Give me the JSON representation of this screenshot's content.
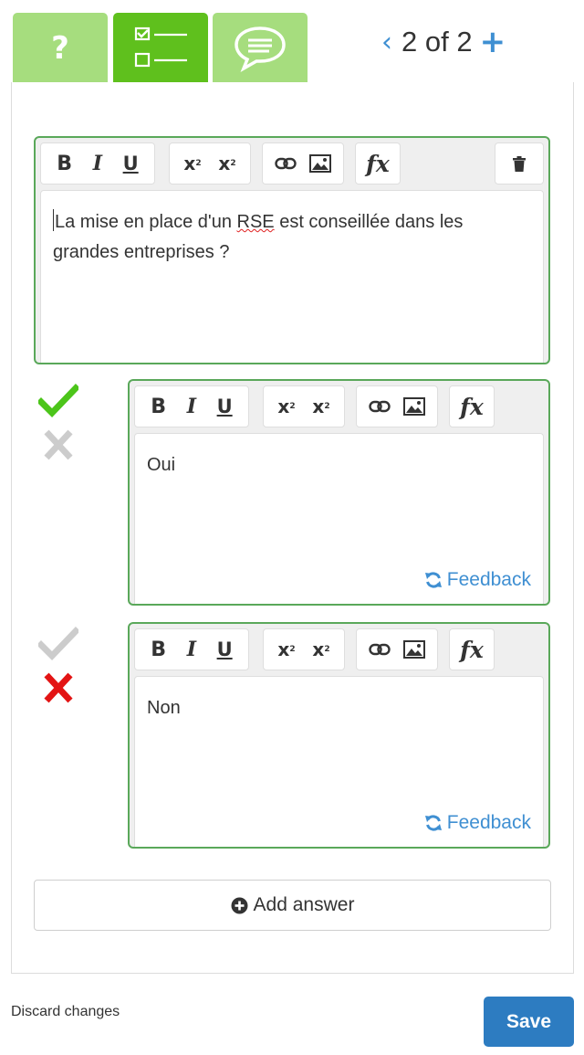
{
  "tabs": [
    {
      "id": "help",
      "icon": "question-mark-icon",
      "label": "?"
    },
    {
      "id": "quiz",
      "icon": "checklist-icon",
      "active": true
    },
    {
      "id": "comments",
      "icon": "speech-bubble-icon"
    }
  ],
  "pager": {
    "text": "2 of 2",
    "prev_icon": "chevron-left-icon",
    "add_icon": "plus-icon"
  },
  "toolbar": {
    "bold": "B",
    "italic": "I",
    "underline": "U",
    "superscript": "x",
    "subscript": "x",
    "link_icon": "link-icon",
    "image_icon": "image-icon",
    "formula": "fx",
    "delete_icon": "trash-icon"
  },
  "question": {
    "text": "La mise en place d'un RSE est conseillée dans les grandes entreprises ?",
    "text_before": "La mise en place d'un ",
    "misspelled": "RSE",
    "text_after": " est conseillée dans les grandes entreprises ?"
  },
  "answers": [
    {
      "text": "Oui",
      "correct": true,
      "feedback_label": "Feedback"
    },
    {
      "text": "Non",
      "correct": false,
      "feedback_label": "Feedback"
    }
  ],
  "add_answer_label": "Add answer",
  "discard_label": "Discard changes",
  "save_label": "Save",
  "colors": {
    "tab_active": "#5fc01d",
    "tab_inactive": "#a6dd7e",
    "editor_border": "#5aa85a",
    "link_blue": "#3f8fd2",
    "save_button": "#2d7cc1",
    "correct_green": "#4cc51a",
    "wrong_red": "#e31414",
    "inactive_gray": "#cccccc"
  }
}
